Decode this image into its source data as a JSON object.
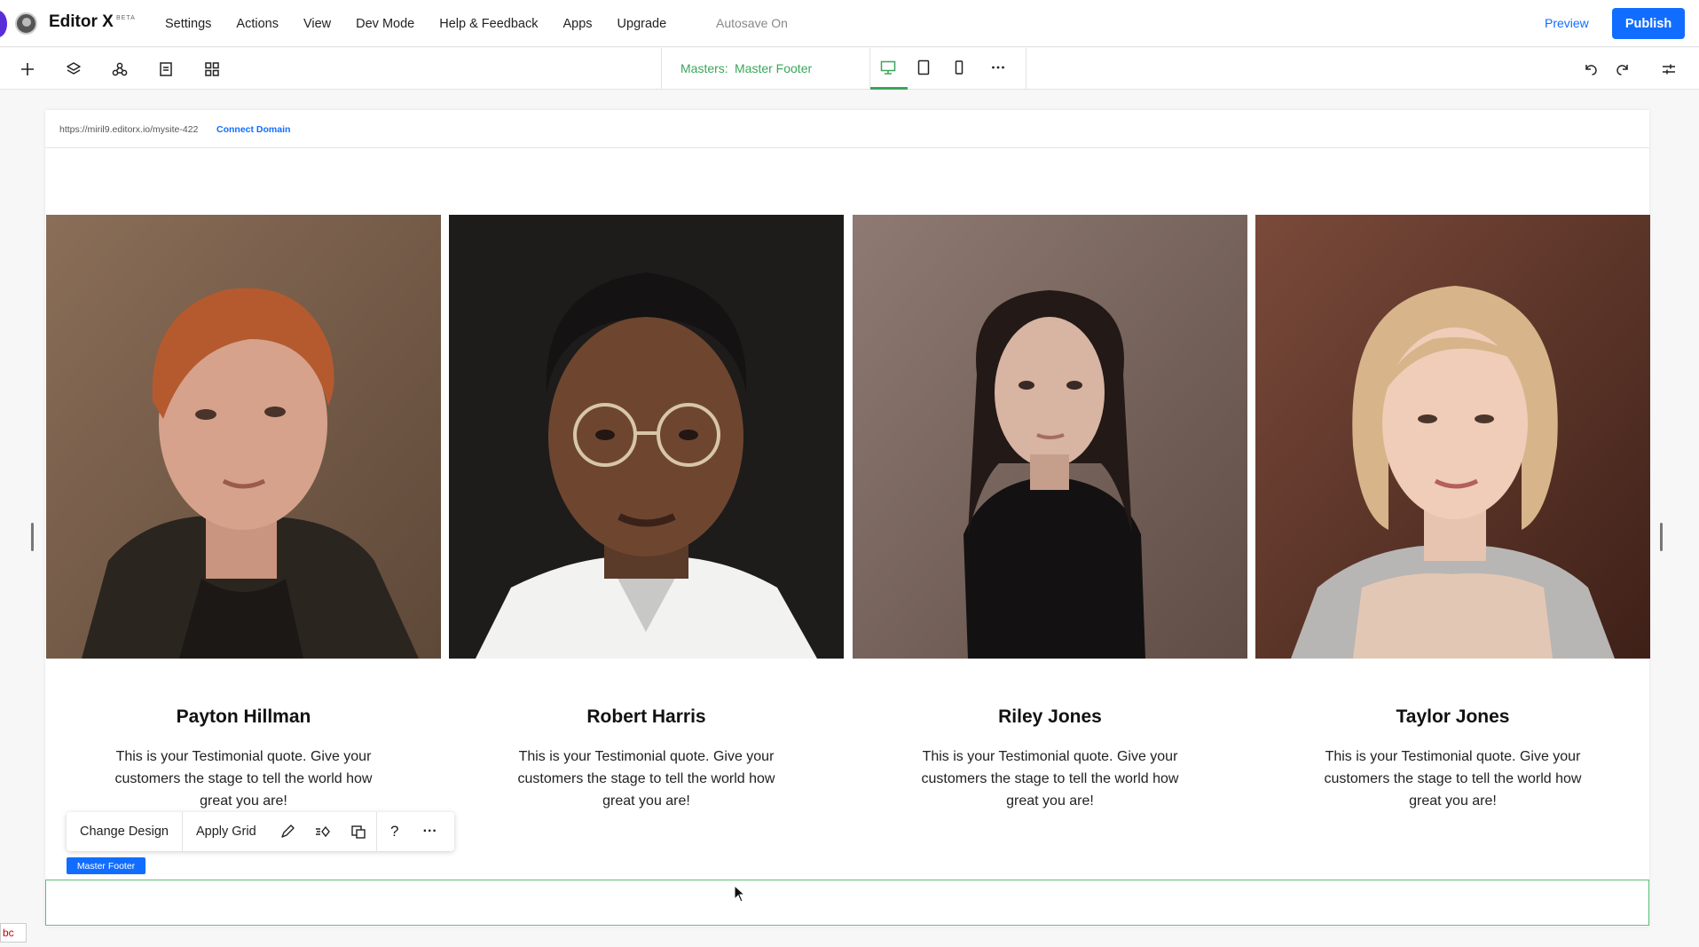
{
  "app": {
    "brand": "Editor X",
    "beta": "BETA",
    "autosave": "Autosave On",
    "preview": "Preview",
    "publish": "Publish"
  },
  "menu": {
    "items": [
      "Settings",
      "Actions",
      "View",
      "Dev Mode",
      "Help & Feedback",
      "Apps",
      "Upgrade"
    ]
  },
  "toolbar": {
    "masters_label": "Masters:",
    "masters_name": "Master Footer",
    "left_icons": [
      "add-icon",
      "layers-icon",
      "components-icon",
      "pages-icon",
      "apps-grid-icon"
    ],
    "device_icons": [
      "desktop-icon",
      "tablet-icon",
      "mobile-icon",
      "more-icon"
    ],
    "right_icons": [
      "undo-icon",
      "redo-icon",
      "settings-sliders-icon"
    ],
    "active_device": "desktop"
  },
  "site": {
    "url": "https://miril9.editorx.io/mysite-422",
    "connect_domain": "Connect Domain"
  },
  "testimonials": [
    {
      "name": "Payton Hillman",
      "quote": "This is your Testimonial quote. Give your customers the stage to tell the world how great you are!"
    },
    {
      "name": "Robert Harris",
      "quote": "This is your Testimonial quote. Give your customers the stage to tell the world how great you are!"
    },
    {
      "name": "Riley Jones",
      "quote": "This is your Testimonial quote. Give your customers the stage to tell the world how great you are!"
    },
    {
      "name": "Taylor Jones",
      "quote": "This is your Testimonial quote. Give your customers the stage to tell the world how great you are!"
    }
  ],
  "actionbar": {
    "change_design": "Change Design",
    "apply_grid": "Apply Grid",
    "icons": [
      "design-brush-icon",
      "animation-icon",
      "layout-icon",
      "help-icon",
      "more-icon"
    ],
    "help_glyph": "?",
    "more_glyph": "···"
  },
  "master_tag": "Master Footer",
  "corner_text": "bc",
  "colors": {
    "accent": "#116dff",
    "masters_green": "#3aa65b"
  }
}
